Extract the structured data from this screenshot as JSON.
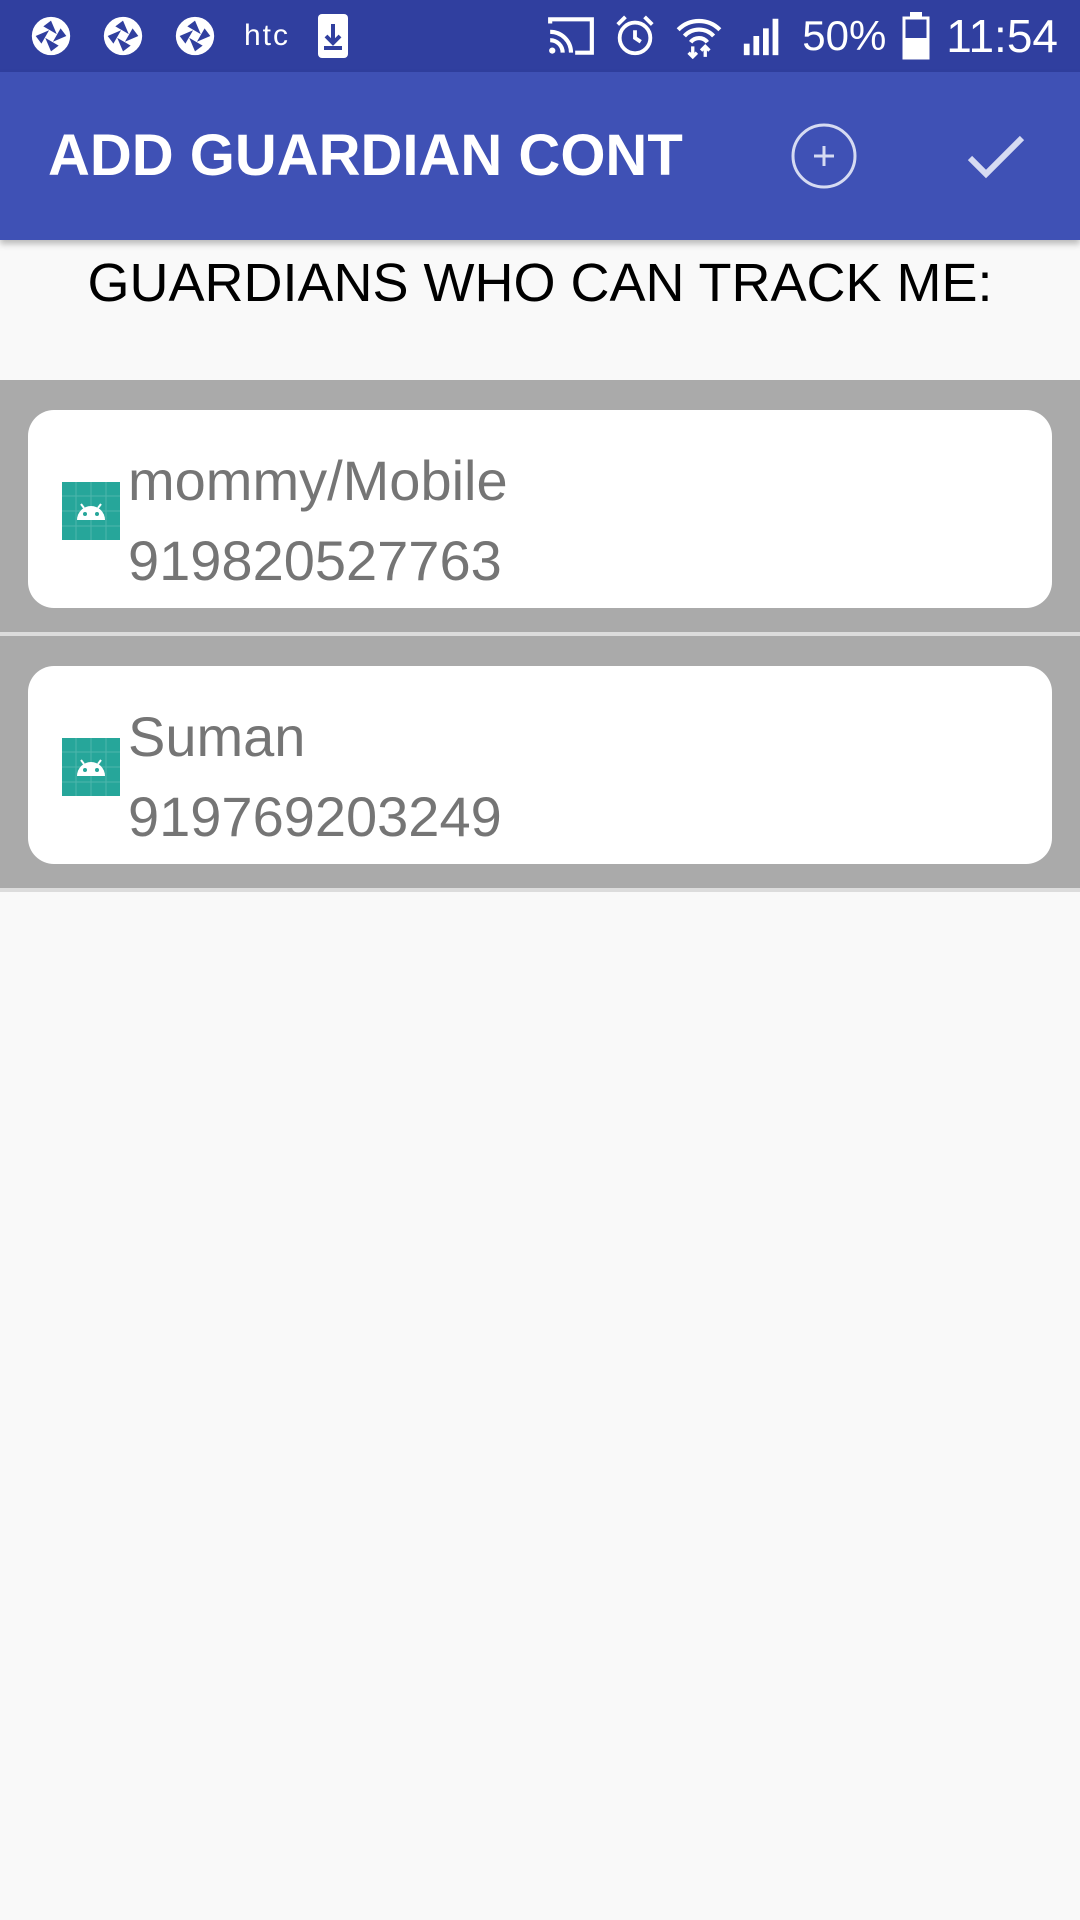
{
  "status_bar": {
    "htc_label": "htc",
    "battery": "50%",
    "time": "11:54",
    "left_icons": [
      "aperture-icon",
      "aperture-icon",
      "aperture-icon",
      "htc-logo",
      "download-icon"
    ],
    "right_icons": [
      "cast-icon",
      "alarm-icon",
      "wifi-icon",
      "signal-icon",
      "battery-icon"
    ]
  },
  "app_bar": {
    "title": "ADD GUARDIAN CONT…",
    "actions": [
      "add-circle-icon",
      "check-icon"
    ]
  },
  "heading": "GUARDIANS WHO CAN TRACK ME:",
  "guardians": [
    {
      "name": "mommy/Mobile",
      "phone": "919820527763",
      "icon": "android-icon"
    },
    {
      "name": "Suman",
      "phone": "919769203249",
      "icon": "android-icon"
    }
  ],
  "colors": {
    "status_bar": "#303f9f",
    "app_bar": "#3f51b5",
    "row_background": "#aaaaaa",
    "avatar": "#26a69a",
    "text_secondary": "#757575"
  }
}
